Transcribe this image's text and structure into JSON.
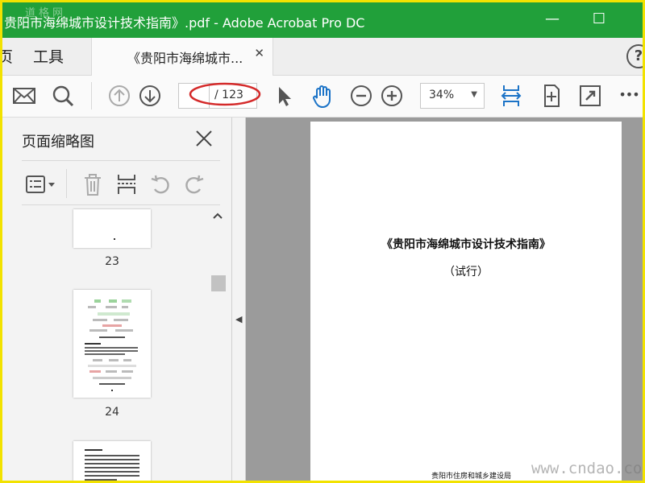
{
  "window": {
    "title": "贵阳市海绵城市设计技术指南》.pdf - Adobe Acrobat Pro DC",
    "watermark_top": "道格网",
    "controls": {
      "minimize": "—",
      "maximize": "☐"
    }
  },
  "tabs": {
    "home_partial": "页",
    "tools": "工具",
    "document_tab": "《贵阳市海绵城市...",
    "close": "✕",
    "help": "?"
  },
  "toolbar": {
    "page_total": "/ 123",
    "zoom": "34%",
    "icons": [
      "mail-icon",
      "search-icon",
      "prev-page-icon",
      "next-page-icon",
      "select-cursor-icon",
      "hand-tool-icon",
      "zoom-out-icon",
      "zoom-in-icon",
      "fit-page-icon",
      "rotate-page-icon",
      "fullscreen-icon",
      "more-icon"
    ],
    "more": "•••",
    "annotation_color": "#d42a2a",
    "accent": "#1b73c7"
  },
  "panel": {
    "title": "页面缩略图",
    "thumbnails": [
      {
        "label": "23"
      },
      {
        "label": "24"
      }
    ]
  },
  "document": {
    "title_line": "《贵阳市海绵城市设计技术指南》",
    "subtitle_line": "（试行）",
    "footer_line": "贵阳市住房和城乡建设局"
  },
  "site_watermark": "www.cndao.com"
}
